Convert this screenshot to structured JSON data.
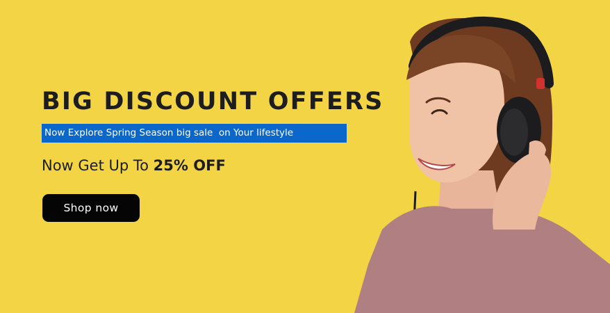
{
  "hero": {
    "headline": "BIG DISCOUNT OFFERS",
    "subline": "Now Explore Spring Season big sale  on Your lifestyle",
    "offer_prefix": "Now Get Up To ",
    "offer_highlight": "25% OFF",
    "cta_label": "Shop now"
  },
  "colors": {
    "background": "#f3d445",
    "highlight_bar": "#0b67c9",
    "button": "#050505",
    "text": "#1d1d1f"
  },
  "image": {
    "icon": "woman-with-headphones-photo"
  }
}
